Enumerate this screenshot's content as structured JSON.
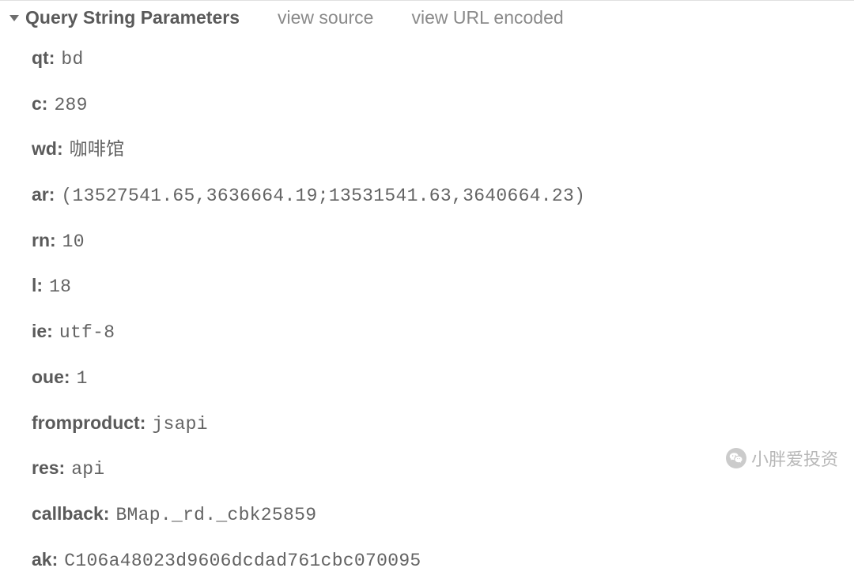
{
  "header": {
    "title": "Query String Parameters",
    "view_source": "view source",
    "view_url_encoded": "view URL encoded"
  },
  "params": [
    {
      "key": "qt:",
      "value": "bd"
    },
    {
      "key": "c:",
      "value": "289"
    },
    {
      "key": "wd:",
      "value": "咖啡馆"
    },
    {
      "key": "ar:",
      "value": "(13527541.65,3636664.19;13531541.63,3640664.23)"
    },
    {
      "key": "rn:",
      "value": "10"
    },
    {
      "key": "l:",
      "value": "18"
    },
    {
      "key": "ie:",
      "value": "utf-8"
    },
    {
      "key": "oue:",
      "value": "1"
    },
    {
      "key": "fromproduct:",
      "value": "jsapi"
    },
    {
      "key": "res:",
      "value": "api"
    },
    {
      "key": "callback:",
      "value": "BMap._rd._cbk25859"
    },
    {
      "key": "ak:",
      "value": "C106a48023d9606dcdad761cbc070095"
    }
  ],
  "watermark": {
    "text": "小胖爱投资"
  }
}
